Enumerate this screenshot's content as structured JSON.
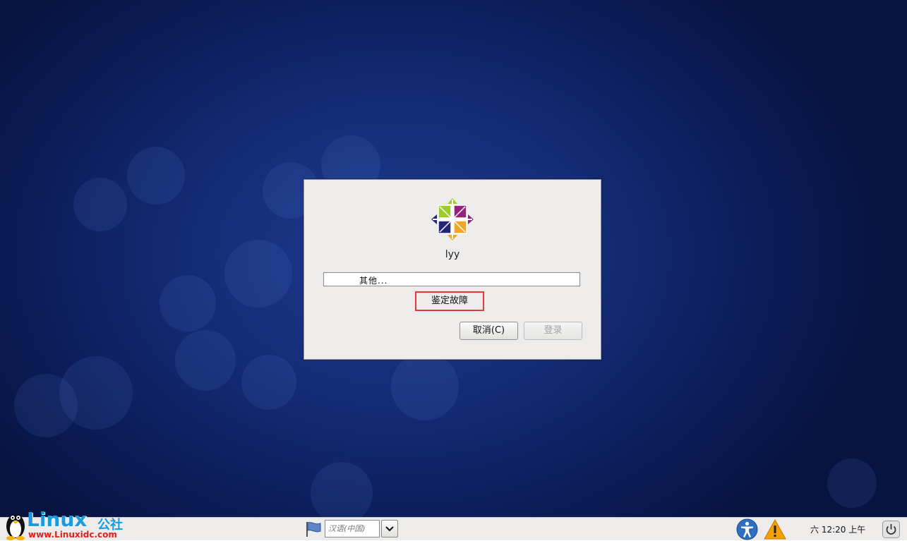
{
  "dialog": {
    "username": "lyy",
    "user_list_entry": "其他...",
    "troubleshoot_label": "鉴定故障",
    "cancel_label": "取消(C)",
    "login_label": "登录"
  },
  "panel": {
    "watermark": {
      "brand": "Linux",
      "brand_suffix": "公社",
      "url": "www.Linuxidc.com"
    },
    "language": {
      "selected": "汉语(中国)",
      "flag_icon": "language-flag-icon",
      "dropdown_icon": "chevron-down-icon"
    },
    "accessibility_icon": "accessibility-icon",
    "warning_icon": "warning-icon",
    "clock": "六 12:20 上午",
    "power_icon": "power-icon"
  },
  "colors": {
    "desktop_bg": "#142c77",
    "highlight_border": "#e23a3a",
    "panel_bg": "#edeceb",
    "watermark_blue": "#1a9be0",
    "watermark_red": "#e02020"
  }
}
